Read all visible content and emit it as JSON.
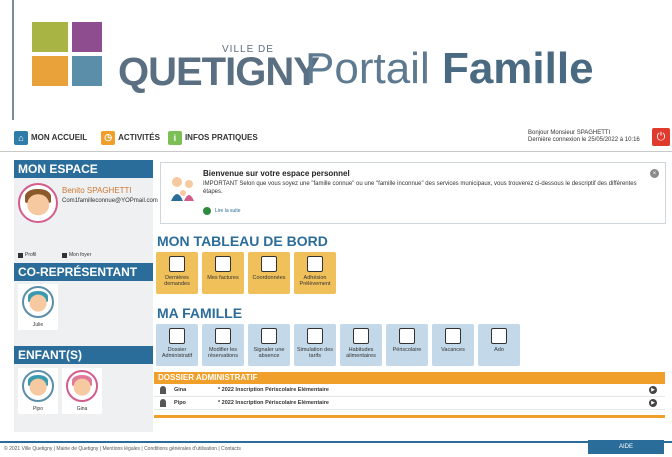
{
  "banner": {
    "ville": "VILLE DE",
    "city": "QUETIGNY",
    "portail": "Portail",
    "famille": "Famille"
  },
  "nav": {
    "home": "MON ACCUEIL",
    "activities": "ACTIVITÉS",
    "info": "INFOS PRATIQUES",
    "greeting": "Bonjour Monsieur SPAGHETTI",
    "last_login": "Dernière connexion le 25/05/2022 à 10:16"
  },
  "sidebar": {
    "mon_espace": "MON ESPACE",
    "user_name": "Benito SPAGHETTI",
    "user_email": "Com1familleconnue@YOPmail.com",
    "profil": "Profil",
    "foyer": "Mon foyer",
    "co_rep_title": "CO-REPRÉSENTANT",
    "co_rep_name": "Julie",
    "children_title": "ENFANT(S)",
    "children": [
      "Pipo",
      "Gina"
    ]
  },
  "welcome": {
    "title": "Bienvenue sur votre espace personnel",
    "text": "IMPORTANT Selon que vous soyez une \"famille connue\" ou une \"famille inconnue\" des services municipaux, vous trouverez ci-dessous le descriptif des différentes étapes.",
    "read_more": "Lire la suite"
  },
  "dashboard": {
    "title": "MON TABLEAU DE BORD",
    "tiles": [
      "Dernières demandes",
      "Mes factures",
      "Coordonnées",
      "Adhésion Prélèvement"
    ]
  },
  "famille": {
    "title": "MA FAMILLE",
    "tiles": [
      "Dossier Administratif",
      "Modifier les réservations",
      "Signaler une absence",
      "Simulation des tarifs",
      "Habitudes alimentaires",
      "Périscolaire",
      "Vacances",
      "Ado"
    ]
  },
  "dossier": {
    "title": "DOSSIER ADMINISTRATIF",
    "rows": [
      {
        "child": "Gina",
        "label": "* 2022 Inscription Périscolaire Elémentaire"
      },
      {
        "child": "Pipo",
        "label": "* 2022 Inscription Périscolaire Elémentaire"
      }
    ]
  },
  "footer": {
    "text": "© 2021 Ville Quetigny | Mairie de Quetigny | Mentions légales | Conditions générales d'utilisation | Contacts",
    "aide": "AIDE"
  },
  "colors": {
    "primary": "#2b6d9a",
    "orange": "#f0a02a",
    "tile_orange": "#f0c15a",
    "tile_blue": "#c3d8e8",
    "logout": "#e03a2e"
  }
}
